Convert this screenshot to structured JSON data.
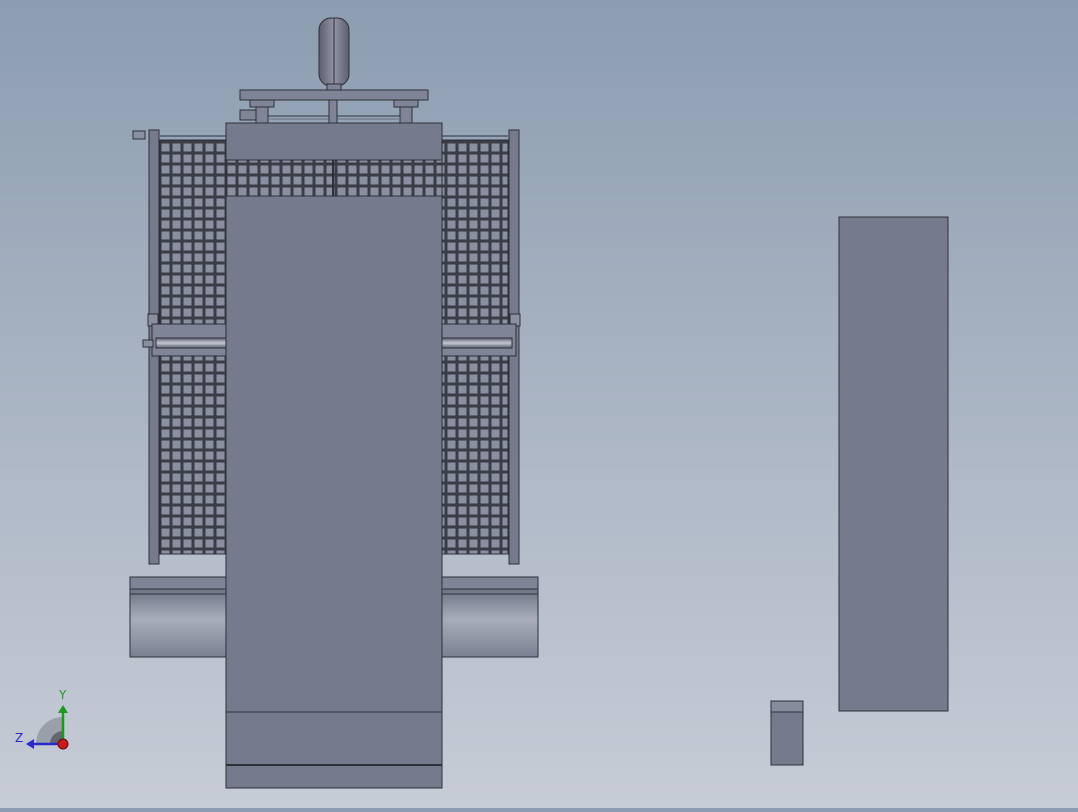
{
  "viewport": {
    "background_top": "#8c9db0",
    "background_bottom": "#c7ccd6"
  },
  "model": {
    "body_color": "#757b8c",
    "body_stroke": "#2e3038",
    "mesh_color": "#7f8596",
    "mesh_line": "#3a3d46"
  },
  "triad": {
    "y_label": "Y",
    "z_label": "Z",
    "y_color": "#1a9a1a",
    "z_color": "#2a2acc",
    "x_color": "#cc1a1a"
  }
}
